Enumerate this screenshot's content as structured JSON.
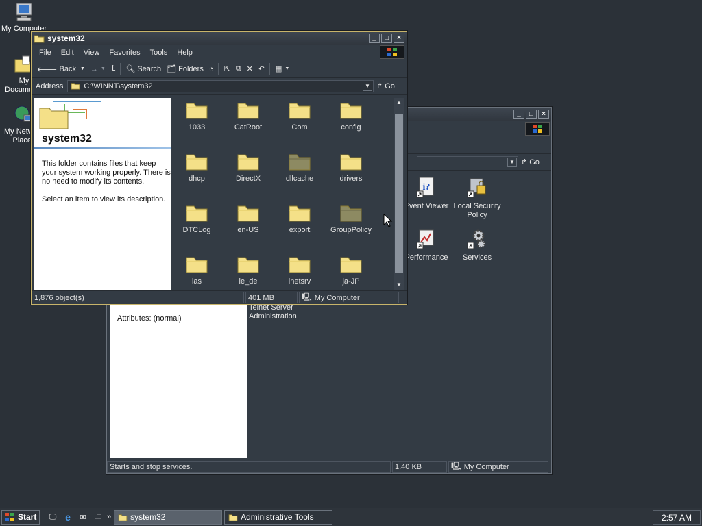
{
  "desktop": {
    "icons": [
      {
        "label": "My Computer"
      },
      {
        "label": "My Documents"
      },
      {
        "label": "My Network Places"
      }
    ]
  },
  "back_window": {
    "address_go": "Go",
    "icons": [
      {
        "label": "Event Viewer"
      },
      {
        "label": "Local Security Policy"
      },
      {
        "label": "Performance"
      },
      {
        "label": "Services"
      },
      {
        "label": "Telnet Server Administration"
      }
    ],
    "details": {
      "attributes": "Attributes: (normal)"
    },
    "status": {
      "text": "Starts and stop services.",
      "size": "1.40 KB",
      "zone": "My Computer"
    }
  },
  "front_window": {
    "title": "system32",
    "menu": [
      "File",
      "Edit",
      "View",
      "Favorites",
      "Tools",
      "Help"
    ],
    "toolbar": {
      "back": "Back",
      "search": "Search",
      "folders": "Folders"
    },
    "address": {
      "label": "Address",
      "value": "C:\\WINNT\\system32",
      "go": "Go"
    },
    "panel": {
      "heading": "system32",
      "description": "This folder contains files that keep your system working properly. There is no need to modify its contents.",
      "hint": "Select an item to view its description."
    },
    "folders": [
      {
        "name": "1033"
      },
      {
        "name": "CatRoot"
      },
      {
        "name": "Com"
      },
      {
        "name": "config"
      },
      {
        "name": "dhcp"
      },
      {
        "name": "DirectX"
      },
      {
        "name": "dllcache"
      },
      {
        "name": "drivers"
      },
      {
        "name": "DTCLog"
      },
      {
        "name": "en-US"
      },
      {
        "name": "export"
      },
      {
        "name": "GroupPolicy"
      },
      {
        "name": "ias"
      },
      {
        "name": "ie_de"
      },
      {
        "name": "inetsrv"
      },
      {
        "name": "ja-JP"
      }
    ],
    "status": {
      "objects": "1,876 object(s)",
      "size": "401 MB",
      "zone": "My Computer"
    }
  },
  "taskbar": {
    "start": "Start",
    "tasks": [
      {
        "label": "system32",
        "active": true
      },
      {
        "label": "Administrative Tools",
        "active": false
      }
    ],
    "clock": "2:57 AM"
  },
  "colors": {
    "desktop": "#2b3138",
    "window": "#333b44",
    "folder": "#f4e088",
    "folder_dim": "#8d8a62",
    "border_accent": "#c8b46a"
  }
}
